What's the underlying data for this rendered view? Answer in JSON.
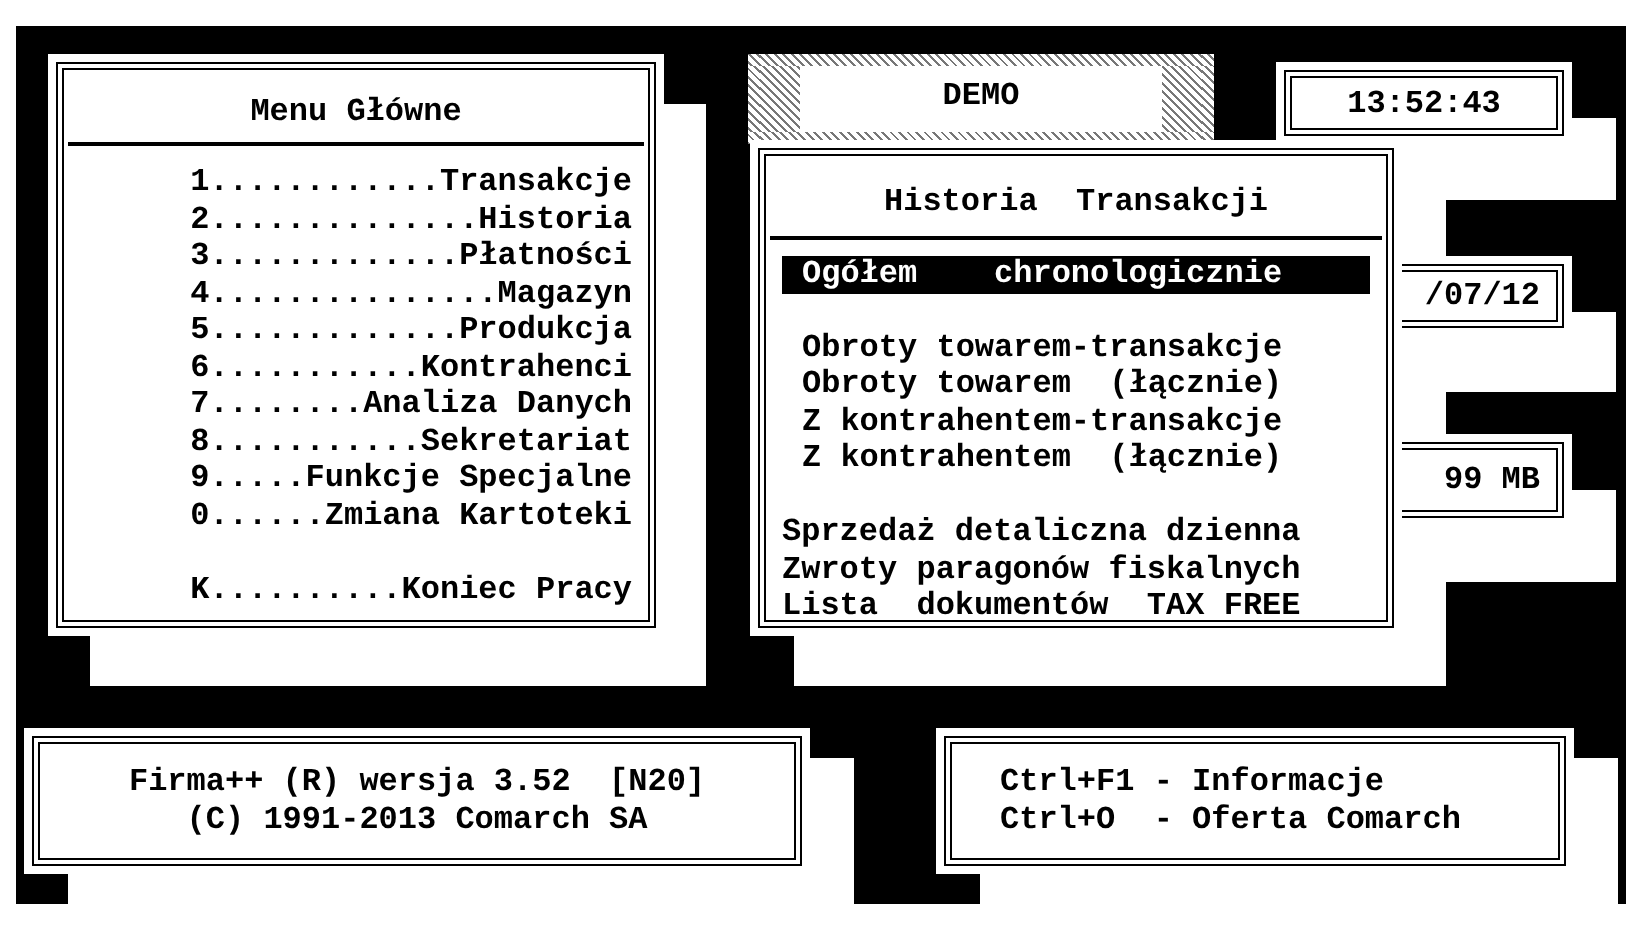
{
  "main_menu": {
    "title": "Menu Główne",
    "items": [
      {
        "label": "1............Transakcje"
      },
      {
        "label": "2..............Historia"
      },
      {
        "label": "3.............Płatności"
      },
      {
        "label": "4...............Magazyn"
      },
      {
        "label": "5.............Produkcja"
      },
      {
        "label": "6...........Kontrahenci"
      },
      {
        "label": "7........Analiza Danych"
      },
      {
        "label": "8...........Sekretariat"
      },
      {
        "label": "9.....Funkcje Specjalne"
      },
      {
        "label": "0......Zmiana Kartoteki"
      }
    ],
    "footer_item": {
      "label": "K..........Koniec Pracy"
    }
  },
  "demo_window": {
    "title": "DEMO"
  },
  "history_window": {
    "title": "Historia  Transakcji",
    "groups": [
      [
        {
          "label": "Ogółem    chronologicznie",
          "selected": true
        }
      ],
      [
        {
          "label": "Obroty towarem-transakcje",
          "selected": false
        },
        {
          "label": "Obroty towarem  (łącznie)",
          "selected": false
        },
        {
          "label": "Z kontrahentem-transakcje",
          "selected": false
        },
        {
          "label": "Z kontrahentem  (łącznie)",
          "selected": false
        }
      ],
      [
        {
          "label": "Sprzedaż detaliczna dzienna",
          "selected": false
        },
        {
          "label": "Zwroty paragonów fiskalnych",
          "selected": false
        },
        {
          "label": "Lista  dokumentów  TAX FREE",
          "selected": false
        }
      ]
    ]
  },
  "clock": "13:52:43",
  "date": "/07/12",
  "memory": "99 MB",
  "version_box": [
    "Firma++ (R) wersja 3.52  [N20]",
    "(C) 1991-2013 Comarch SA"
  ],
  "shortcuts_box": [
    "Ctrl+F1 - Informacje",
    "Ctrl+O  - Oferta Comarch"
  ]
}
